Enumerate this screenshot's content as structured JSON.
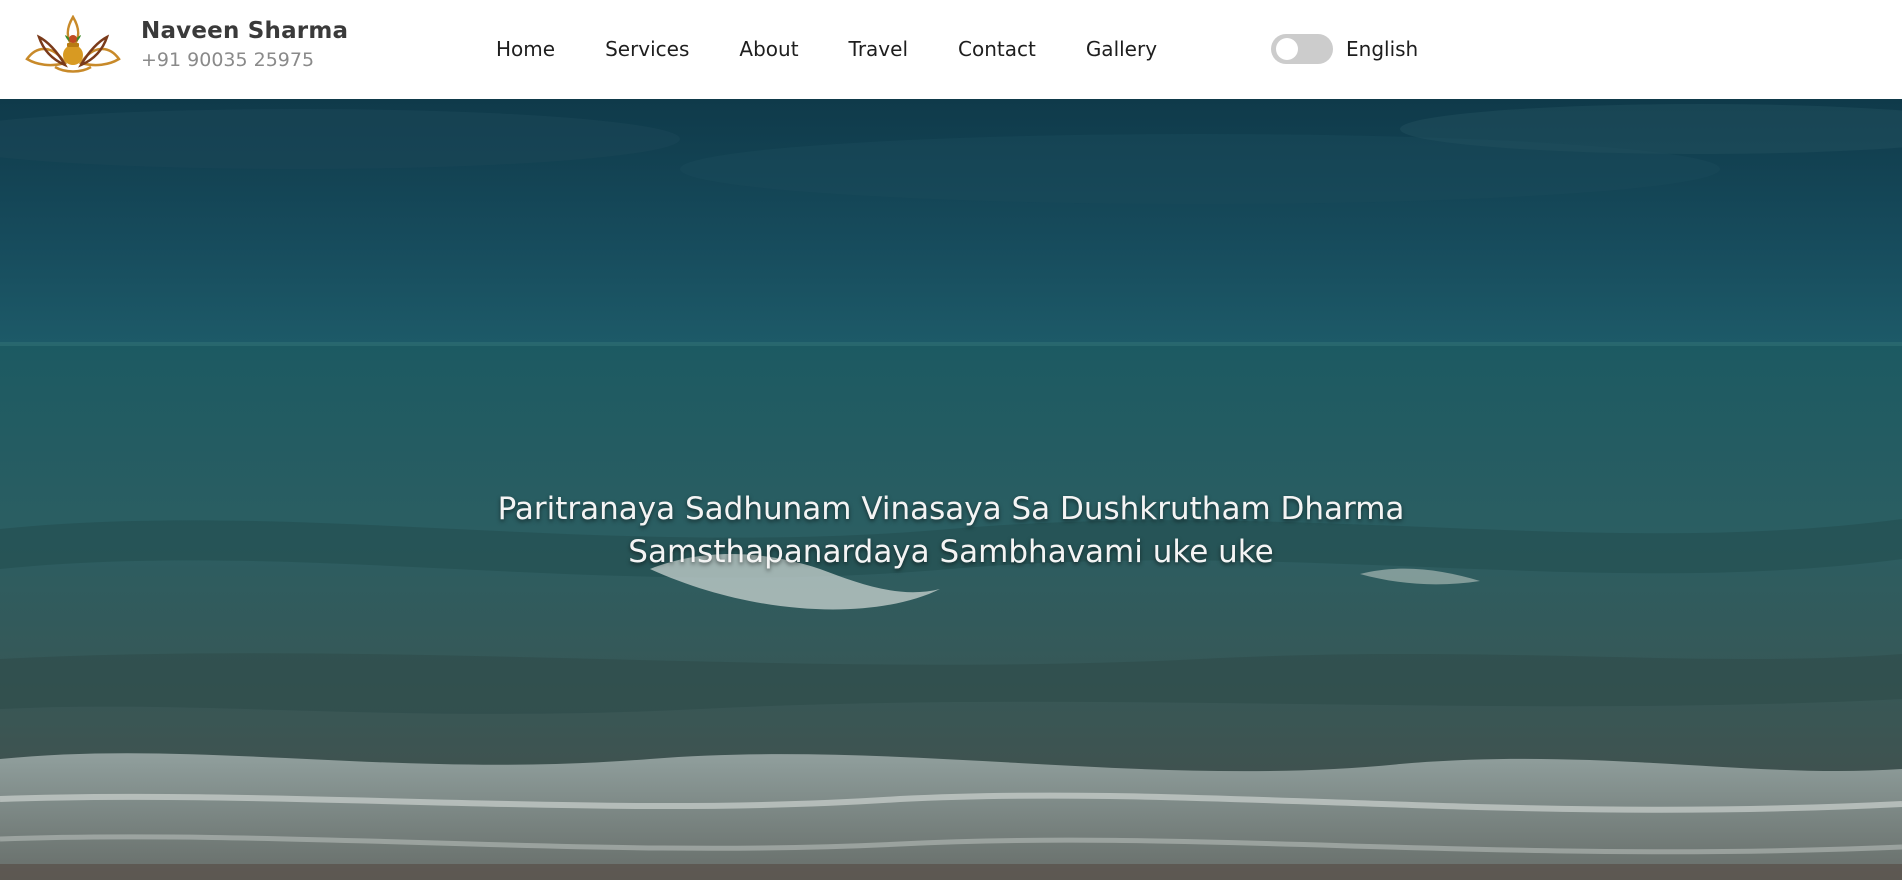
{
  "brand": {
    "name": "Naveen Sharma",
    "phone": "+91 90035 25975",
    "logo_icon": "lotus-kalash-icon"
  },
  "nav": {
    "items": [
      {
        "label": "Home"
      },
      {
        "label": "Services"
      },
      {
        "label": "About"
      },
      {
        "label": "Travel"
      },
      {
        "label": "Contact"
      },
      {
        "label": "Gallery"
      }
    ]
  },
  "language": {
    "label": "English",
    "toggle_on": false
  },
  "hero": {
    "line1": "Paritranaya Sadhunam Vinasaya Sa Dushkrutham Dharma",
    "line2": "Samsthapanardaya Sambhavami uke uke",
    "background_image": "ocean-waves-image"
  },
  "colors": {
    "header_bg": "#ffffff",
    "nav_text": "#1e1e1e",
    "brand_name": "#3a3a3a",
    "brand_phone": "#8a8a8a",
    "toggle_off": "#cccccc",
    "hero_text": "#f4f4f4"
  }
}
